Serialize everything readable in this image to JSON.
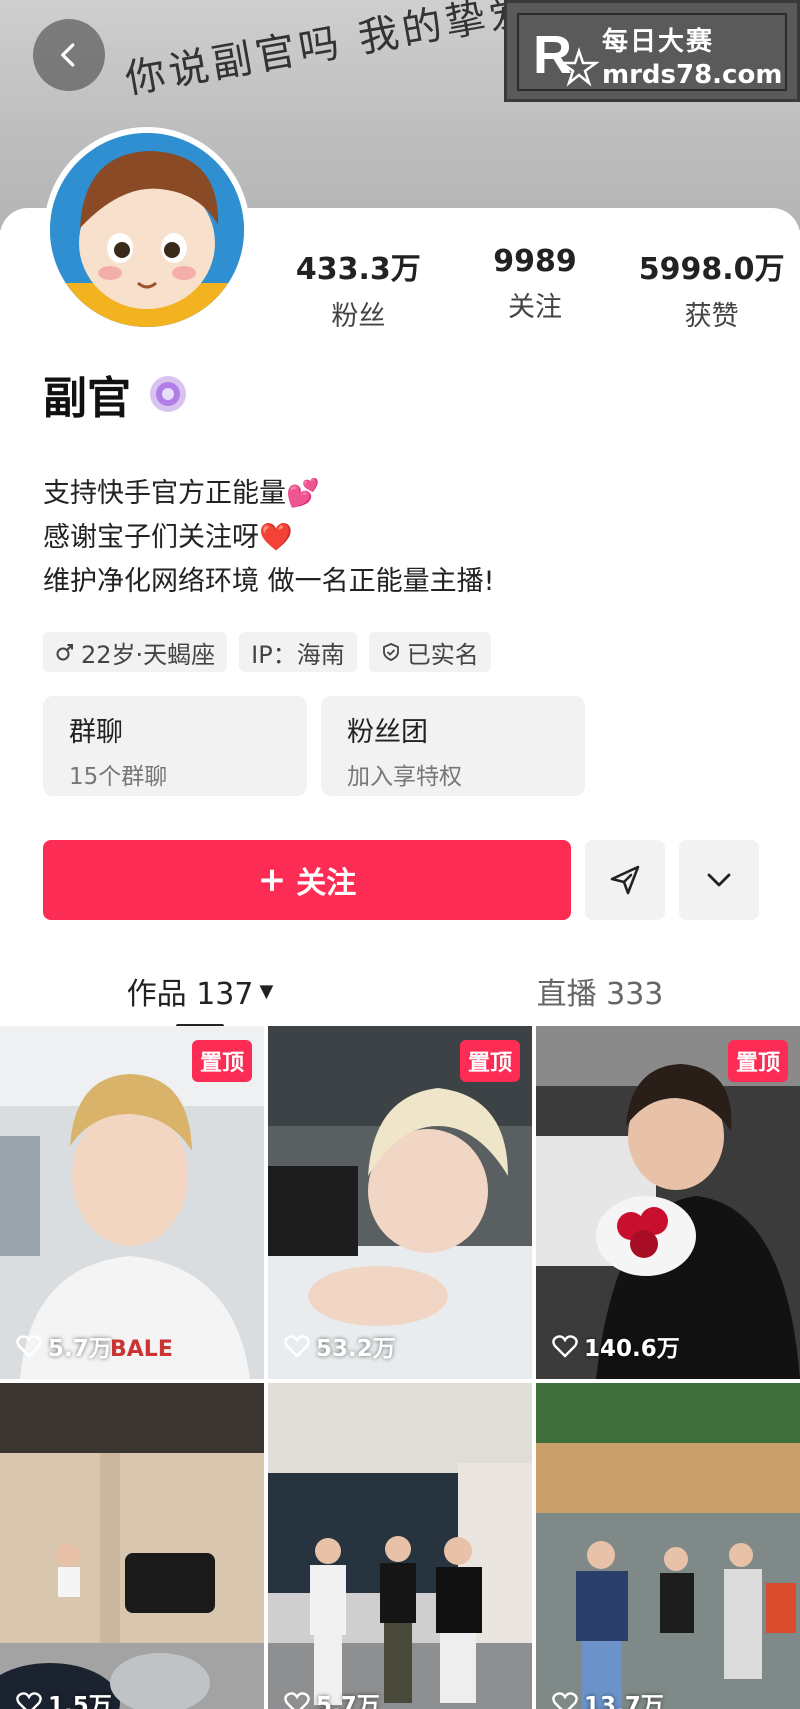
{
  "banner": {
    "text": "你说副官吗 我的挚爱"
  },
  "watermark": {
    "line1": "每日大赛",
    "line2": "mrds78.com"
  },
  "profile": {
    "name": "副官",
    "stats": [
      {
        "value": "433.3万",
        "label": "粉丝"
      },
      {
        "value": "9989",
        "label": "关注"
      },
      {
        "value": "5998.0万",
        "label": "获赞"
      }
    ],
    "bio": [
      "支持快手官方正能量💕",
      "感谢宝子们关注呀❤️",
      "维护净化网络环境 做一名正能量主播!"
    ],
    "tags": {
      "age": "22岁·天蝎座",
      "ip": "IP：海南",
      "verified": "已实名"
    }
  },
  "tiles": [
    {
      "title": "群聊",
      "subtitle": "15个群聊"
    },
    {
      "title": "粉丝团",
      "subtitle": "加入享特权"
    }
  ],
  "actions": {
    "follow_label": "关注",
    "follow_plus": "+"
  },
  "tabs": {
    "works": "作品 137",
    "live": "直播 333"
  },
  "colors": {
    "accent": "#fd2c55"
  },
  "videos": [
    {
      "likes": "5.7万",
      "pinned": "置顶"
    },
    {
      "likes": "53.2万",
      "pinned": "置顶"
    },
    {
      "likes": "140.6万",
      "pinned": "置顶"
    },
    {
      "likes": "1.5万",
      "pinned": ""
    },
    {
      "likes": "5.7万",
      "pinned": ""
    },
    {
      "likes": "13.7万",
      "pinned": ""
    }
  ]
}
